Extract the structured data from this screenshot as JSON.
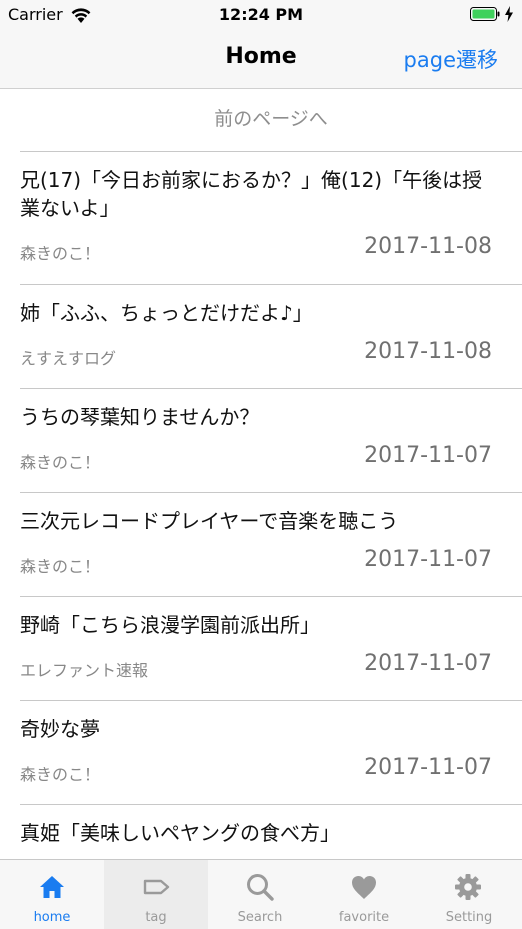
{
  "status_bar": {
    "carrier": "Carrier",
    "time": "12:24 PM"
  },
  "nav": {
    "title": "Home",
    "right_button": "page遷移"
  },
  "prev_page_label": "前のページへ",
  "articles": [
    {
      "title": "兄(17)「今日お前家におるか？」俺(12)「午後は授業ないよ」",
      "source": "森きのこ！",
      "date": "2017-11-08"
    },
    {
      "title": "姉「ふふ、ちょっとだけだよ♪」",
      "source": "えすえすログ",
      "date": "2017-11-08"
    },
    {
      "title": "うちの琴葉知りませんか？",
      "source": "森きのこ！",
      "date": "2017-11-07"
    },
    {
      "title": "三次元レコードプレイヤーで音楽を聴こう",
      "source": "森きのこ！",
      "date": "2017-11-07"
    },
    {
      "title": "野崎「こちら浪漫学園前派出所」",
      "source": "エレファント速報",
      "date": "2017-11-07"
    },
    {
      "title": "奇妙な夢",
      "source": "森きのこ！",
      "date": "2017-11-07"
    },
    {
      "title": "真姫「美味しいペヤングの食べ方」"
    }
  ],
  "tabs": [
    {
      "label": "home",
      "icon": "home-icon",
      "active": true
    },
    {
      "label": "tag",
      "icon": "tag-icon"
    },
    {
      "label": "Search",
      "icon": "search-icon"
    },
    {
      "label": "favorite",
      "icon": "heart-icon"
    },
    {
      "label": "Setting",
      "icon": "gear-icon"
    }
  ],
  "colors": {
    "accent": "#1a7cf0",
    "inactive": "#9a9a9a",
    "separator": "#c8c8c8"
  }
}
